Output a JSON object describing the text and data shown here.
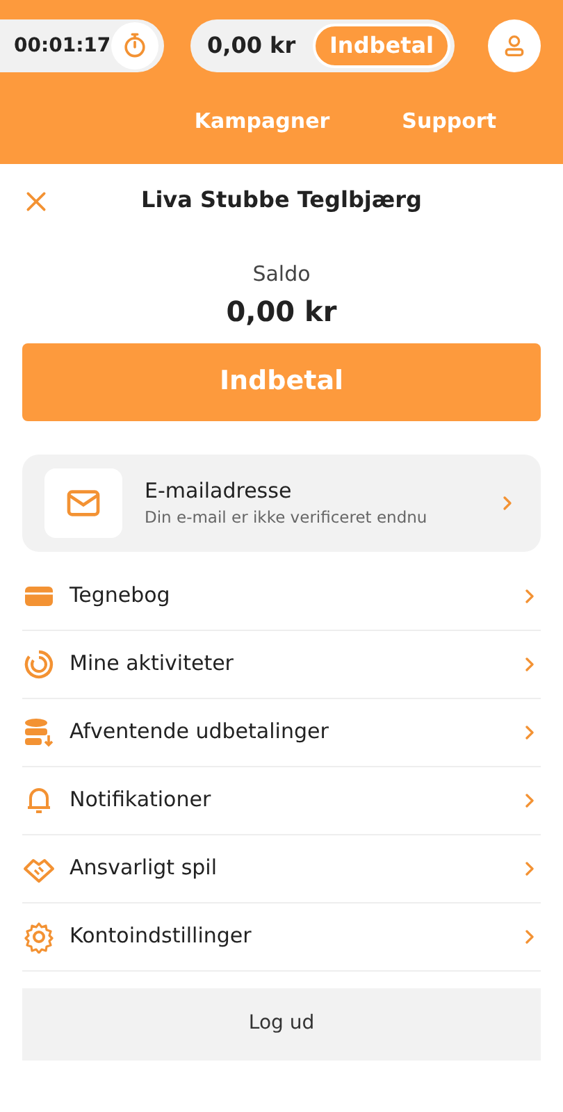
{
  "header": {
    "timer": "00:01:17",
    "balance": "0,00 kr",
    "deposit_label": "Indbetal",
    "nav": [
      "Kampagner",
      "Support"
    ]
  },
  "account": {
    "name": "Liva Stubbe Teglbjærg",
    "balance_label": "Saldo",
    "balance": "0,00 kr",
    "deposit_button": "Indbetal"
  },
  "email_card": {
    "title": "E-mailadresse",
    "subtitle": "Din e-mail er ikke verificeret endnu"
  },
  "menu": [
    {
      "label": "Tegnebog"
    },
    {
      "label": "Mine aktiviteter"
    },
    {
      "label": "Afventende udbetalinger"
    },
    {
      "label": "Notifikationer"
    },
    {
      "label": "Ansvarligt spil"
    },
    {
      "label": "Kontoindstillinger"
    }
  ],
  "logout": "Log ud"
}
